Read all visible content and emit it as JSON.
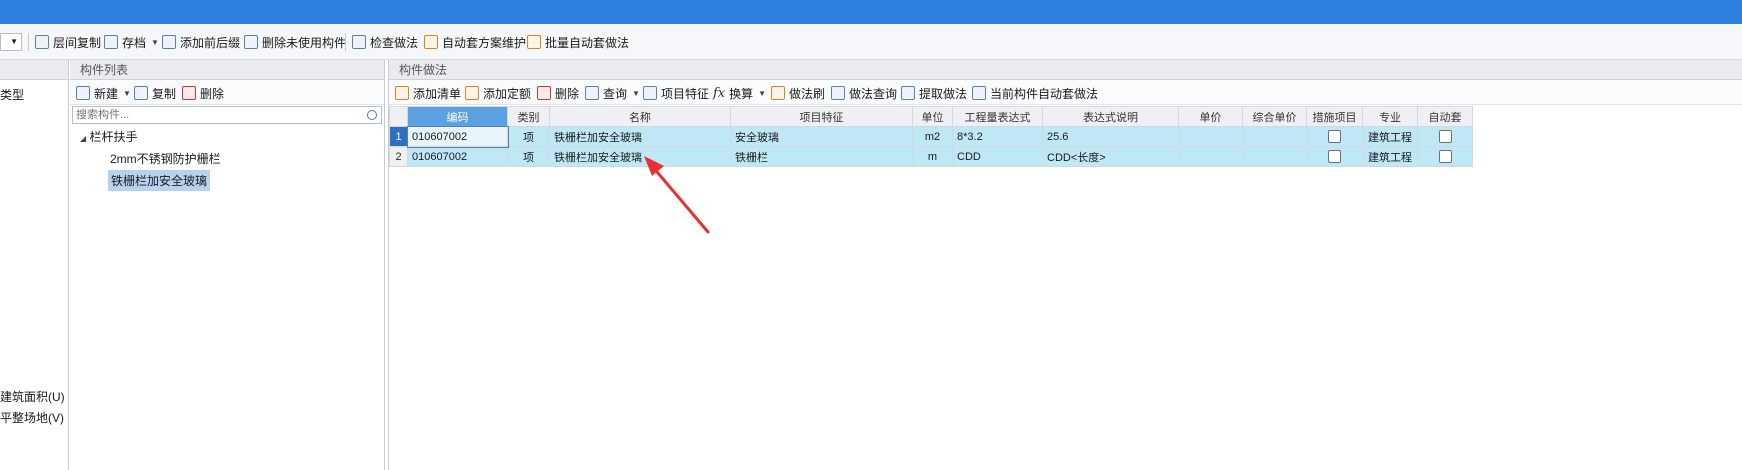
{
  "toolbar": {
    "items": [
      {
        "label": "层间复制",
        "icon": "floor-copy-icon"
      },
      {
        "label": "存档",
        "icon": "archive-icon",
        "has_dropdown": true
      },
      {
        "label": "添加前后缀",
        "icon": "add-prefix-suffix-icon"
      },
      {
        "label": "删除未使用构件",
        "icon": "delete-unused-icon"
      },
      {
        "label": "检查做法",
        "icon": "check-method-icon"
      },
      {
        "label": "自动套方案维护",
        "icon": "auto-scheme-icon"
      },
      {
        "label": "批量自动套做法",
        "icon": "batch-auto-icon"
      }
    ]
  },
  "left_panel": {
    "header": "",
    "type_label": "类型",
    "bottom_items": [
      "建筑面积(U)",
      "平整场地(V)"
    ]
  },
  "component_list": {
    "title": "构件列表",
    "actions": [
      {
        "label": "新建",
        "has_dropdown": true
      },
      {
        "label": "复制"
      },
      {
        "label": "删除"
      }
    ],
    "search_placeholder": "搜索构件...",
    "tree": {
      "group": "栏杆扶手",
      "children": [
        "2mm不锈钢防护栅栏",
        "铁栅栏加安全玻璃"
      ],
      "selected": "铁栅栏加安全玻璃"
    }
  },
  "methods_panel": {
    "title": "构件做法",
    "actions": [
      {
        "label": "添加清单"
      },
      {
        "label": "添加定额"
      },
      {
        "label": "删除"
      },
      {
        "label": "查询",
        "has_dropdown": true
      },
      {
        "label": "项目特征"
      },
      {
        "label": "换算",
        "has_dropdown": true
      },
      {
        "label": "做法刷"
      },
      {
        "label": "做法查询"
      },
      {
        "label": "提取做法"
      },
      {
        "label": "当前构件自动套做法"
      }
    ],
    "columns": [
      "编码",
      "类别",
      "名称",
      "项目特征",
      "单位",
      "工程量表达式",
      "表达式说明",
      "单价",
      "综合单价",
      "措施项目",
      "专业",
      "自动套"
    ],
    "rows": [
      {
        "num": "1",
        "code": "010607002",
        "category": "项",
        "name": "铁栅栏加安全玻璃",
        "feature": "安全玻璃",
        "unit": "m2",
        "expr": "8*3.2",
        "expr_desc": "25.6",
        "price": "",
        "total_price": "",
        "measure": false,
        "major": "建筑工程",
        "auto": false
      },
      {
        "num": "2",
        "code": "010607002",
        "category": "项",
        "name": "铁栅栏加安全玻璃",
        "feature": "铁栅栏",
        "unit": "m",
        "expr": "CDD",
        "expr_desc": "CDD<长度>",
        "price": "",
        "total_price": "",
        "measure": false,
        "major": "建筑工程",
        "auto": false
      }
    ]
  },
  "colors": {
    "titlebar": "#2f7fe0",
    "row_highlight": "#bfe8f7",
    "selected_header": "#5ba0e0",
    "annotation_arrow": "#e8322f"
  }
}
